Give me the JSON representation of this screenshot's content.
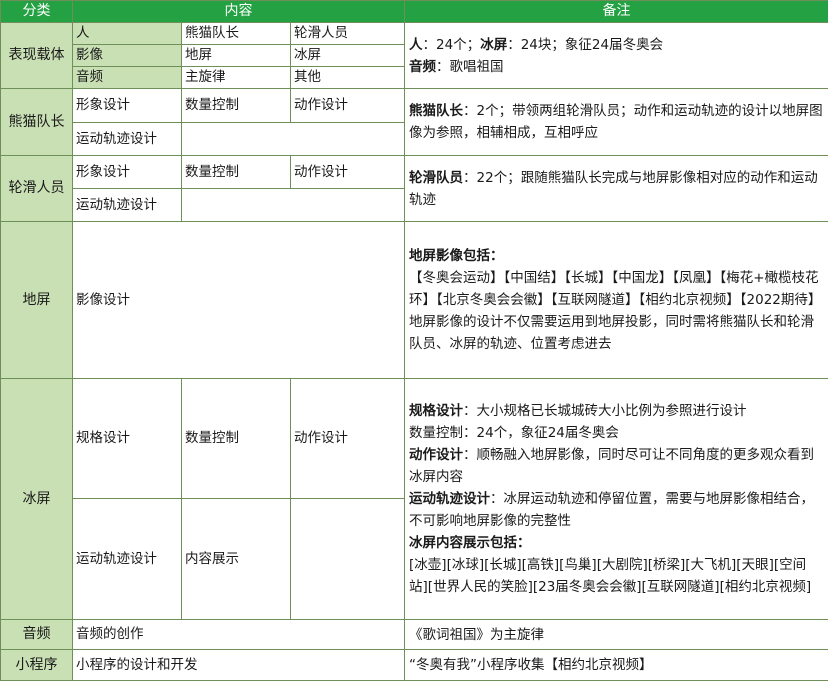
{
  "header": {
    "category": "分类",
    "content": "内容",
    "note": "备注"
  },
  "rows": {
    "carrier": {
      "category": "表现载体",
      "r1": [
        "人",
        "熊猫队长",
        "轮滑人员"
      ],
      "r2": [
        "影像",
        "地屏",
        "冰屏"
      ],
      "r3": [
        "音频",
        "主旋律",
        "其他"
      ],
      "note1_bold": "人",
      "note1": "：24个；",
      "note2_bold": "冰屏",
      "note2": "：24块；象征24届冬奥会",
      "note3_bold": "音频",
      "note3": "：歌唱祖国"
    },
    "panda": {
      "category": "熊猫队长",
      "r1": [
        "形象设计",
        "数量控制",
        "动作设计"
      ],
      "r2": [
        "运动轨迹设计"
      ],
      "note_bold": "熊猫队长",
      "note": "：2个；带领两组轮滑队员；动作和运动轨迹的设计以地屏图像为参照，相辅相成，互相呼应"
    },
    "skaters": {
      "category": "轮滑人员",
      "r1": [
        "形象设计",
        "数量控制",
        "动作设计"
      ],
      "r2": [
        "运动轨迹设计"
      ],
      "note_bold": "轮滑队员",
      "note": "：22个；跟随熊猫队长完成与地屏影像相对应的动作和运动轨迹"
    },
    "floor": {
      "category": "地屏",
      "content": "影像设计",
      "note_title": "地屏影像包括：",
      "note_list": "【冬奥会运动】【中国结】【长城】【中国龙】【凤凰】【梅花+橄榄枝花环】【北京冬奥会会徽】【互联网隧道】【相约北京视频】【2022期待】",
      "note_text": "地屏影像的设计不仅需要运用到地屏投影，同时需将熊猫队长和轮滑队员、冰屏的轨迹、位置考虑进去"
    },
    "ice": {
      "category": "冰屏",
      "r1": [
        "规格设计",
        "数量控制",
        "动作设计"
      ],
      "r2": [
        "运动轨迹设计",
        "内容展示"
      ],
      "n1_bold": "规格设计",
      "n1": "：大小规格已长城城砖大小比例为参照进行设计",
      "n2": "数量控制：24个，象征24届冬奥会",
      "n3_bold": "动作设计",
      "n3": "：顺畅融入地屏影像，同时尽可让不同角度的更多观众看到冰屏内容",
      "n4_bold": "运动轨迹设计",
      "n4": "：冰屏运动轨迹和停留位置，需要与地屏影像相结合，不可影响地屏影像的完整性",
      "n5_bold": "冰屏内容展示包括：",
      "n5": "[冰壶][冰球][长城][高铁][鸟巢][大剧院][桥梁][大飞机][天眼][空间站][世界人民的笑脸][23届冬奥会会徽][互联网隧道][相约北京视频]"
    },
    "audio": {
      "category": "音频",
      "content": "音频的创作",
      "note": "《歌词祖国》为主旋律"
    },
    "miniprogram": {
      "category": "小程序",
      "content": "小程序的设计和开发",
      "note": "“冬奥有我”小程序收集【相约北京视频】"
    }
  },
  "colors": {
    "header_bg": "#24a243",
    "category_bg": "#c9dfb4",
    "border": "#6f8f5a"
  }
}
